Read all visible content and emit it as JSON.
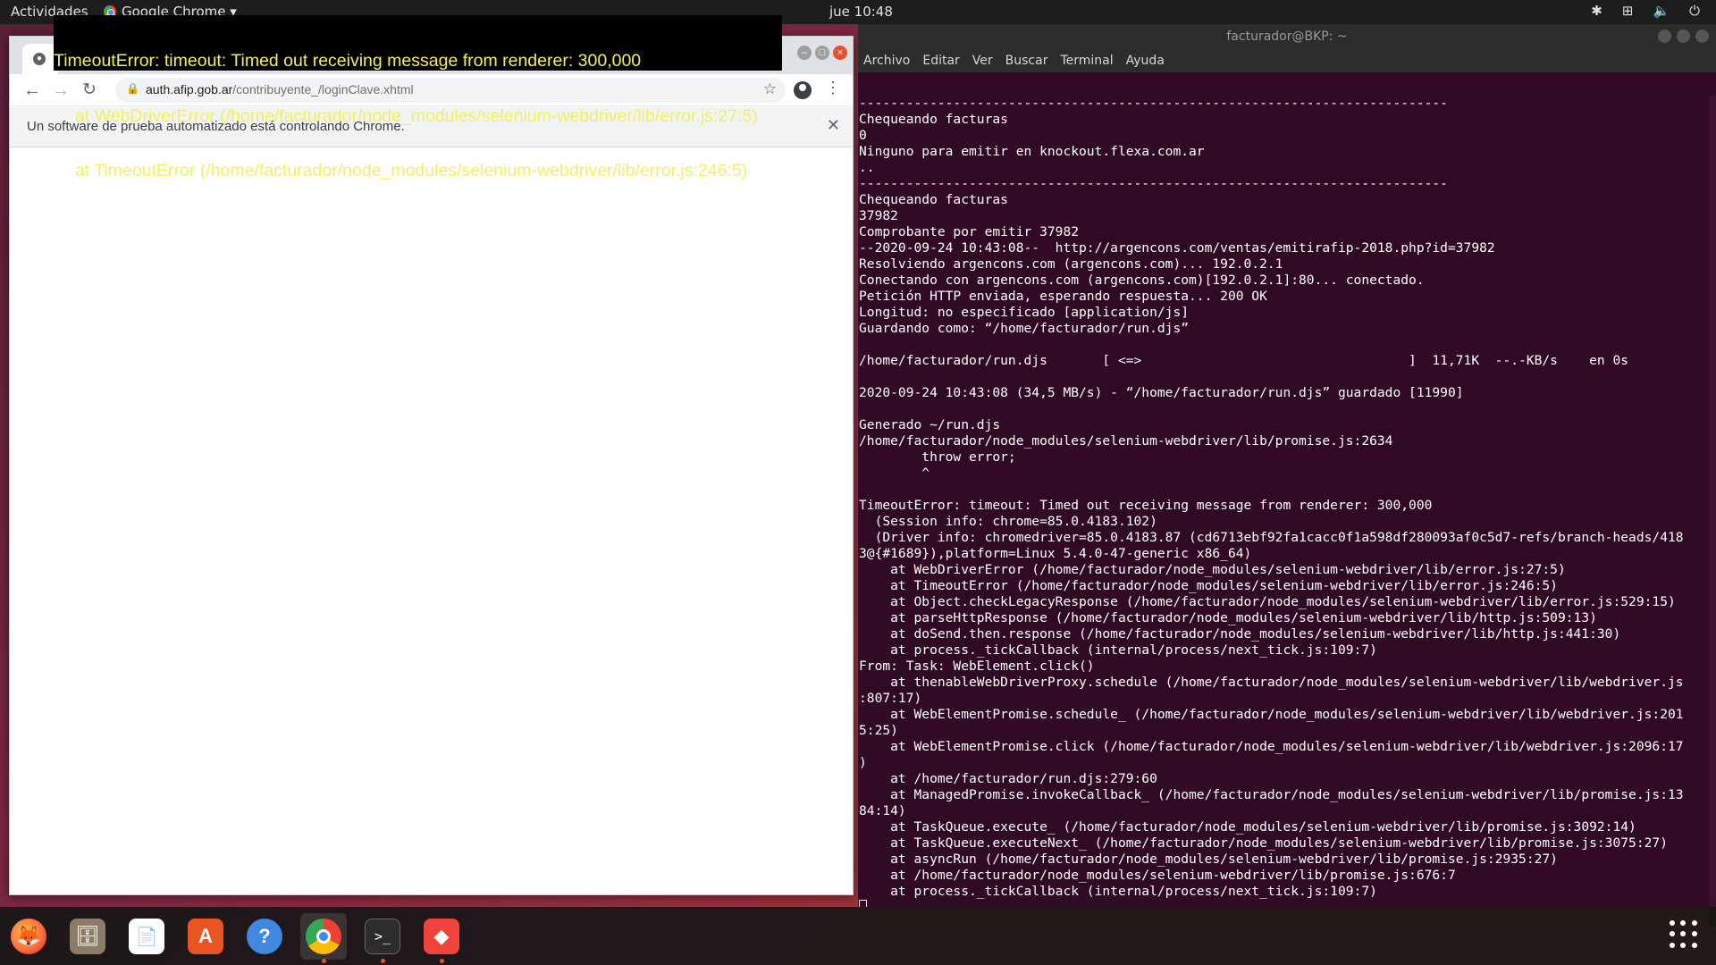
{
  "topbar": {
    "activities": "Actividades",
    "app_menu": "Google Chrome ▾",
    "clock": "jue 10:48",
    "tray_icons": [
      "bluetooth-icon",
      "network-icon",
      "volume-icon",
      "power-icon"
    ]
  },
  "notification": {
    "lines": [
      "TimeoutError: timeout: Timed out receiving message from renderer: 300,000",
      "at WebDriverError (/home/facturador/node_modules/selenium-webdriver/lib/error.js:27:5)",
      "at TimeoutError (/home/facturador/node_modules/selenium-webdriver/lib/error.js:246:5)"
    ]
  },
  "chrome": {
    "url_host": "auth.afip.gob.ar",
    "url_path": "/contribuyente_/loginClave.xhtml",
    "infobar_message": "Un software de prueba automatizado está controlando Chrome."
  },
  "terminal": {
    "title": "facturador@BKP: ~",
    "menu": [
      "Archivo",
      "Editar",
      "Ver",
      "Buscar",
      "Terminal",
      "Ayuda"
    ],
    "lines": [
      "---------------------------------------------------------------------------",
      "Chequeando facturas",
      "0",
      "Ninguno para emitir en knockout.flexa.com.ar",
      "..",
      "---------------------------------------------------------------------------",
      "Chequeando facturas",
      "37982",
      "Comprobante por emitir 37982",
      "--2020-09-24 10:43:08--  http://argencons.com/ventas/emitirafip-2018.php?id=37982",
      "Resolviendo argencons.com (argencons.com)... 192.0.2.1",
      "Conectando con argencons.com (argencons.com)[192.0.2.1]:80... conectado.",
      "Petición HTTP enviada, esperando respuesta... 200 OK",
      "Longitud: no especificado [application/js]",
      "Guardando como: “/home/facturador/run.djs”",
      "",
      "/home/facturador/run.djs       [ <=>                                  ]  11,71K  --.-KB/s    en 0s",
      "",
      "2020-09-24 10:43:08 (34,5 MB/s) - “/home/facturador/run.djs” guardado [11990]",
      "",
      "Generado ~/run.djs",
      "/home/facturador/node_modules/selenium-webdriver/lib/promise.js:2634",
      "        throw error;",
      "        ^",
      "",
      "TimeoutError: timeout: Timed out receiving message from renderer: 300,000",
      "  (Session info: chrome=85.0.4183.102)",
      "  (Driver info: chromedriver=85.0.4183.87 (cd6713ebf92fa1cacc0f1a598df280093af0c5d7-refs/branch-heads/418",
      "3@{#1689}),platform=Linux 5.4.0-47-generic x86_64)",
      "    at WebDriverError (/home/facturador/node_modules/selenium-webdriver/lib/error.js:27:5)",
      "    at TimeoutError (/home/facturador/node_modules/selenium-webdriver/lib/error.js:246:5)",
      "    at Object.checkLegacyResponse (/home/facturador/node_modules/selenium-webdriver/lib/error.js:529:15)",
      "    at parseHttpResponse (/home/facturador/node_modules/selenium-webdriver/lib/http.js:509:13)",
      "    at doSend.then.response (/home/facturador/node_modules/selenium-webdriver/lib/http.js:441:30)",
      "    at process._tickCallback (internal/process/next_tick.js:109:7)",
      "From: Task: WebElement.click()",
      "    at thenableWebDriverProxy.schedule (/home/facturador/node_modules/selenium-webdriver/lib/webdriver.js",
      ":807:17)",
      "    at WebElementPromise.schedule_ (/home/facturador/node_modules/selenium-webdriver/lib/webdriver.js:201",
      "5:25)",
      "    at WebElementPromise.click (/home/facturador/node_modules/selenium-webdriver/lib/webdriver.js:2096:17",
      ")",
      "    at /home/facturador/run.djs:279:60",
      "    at ManagedPromise.invokeCallback_ (/home/facturador/node_modules/selenium-webdriver/lib/promise.js:13",
      "84:14)",
      "    at TaskQueue.execute_ (/home/facturador/node_modules/selenium-webdriver/lib/promise.js:3092:14)",
      "    at TaskQueue.executeNext_ (/home/facturador/node_modules/selenium-webdriver/lib/promise.js:3075:27)",
      "    at asyncRun (/home/facturador/node_modules/selenium-webdriver/lib/promise.js:2935:27)",
      "    at /home/facturador/node_modules/selenium-webdriver/lib/promise.js:676:7",
      "    at process._tickCallback (internal/process/next_tick.js:109:7)"
    ]
  },
  "dock": {
    "items": [
      {
        "icon": "firefox-icon",
        "color": "#ff7139"
      },
      {
        "icon": "files-icon",
        "color": "#7a6a55"
      },
      {
        "icon": "writer-icon",
        "color": "#2a6fbf"
      },
      {
        "icon": "software-center-icon",
        "color": "#e95420"
      },
      {
        "icon": "help-icon",
        "color": "#3f8ae0"
      },
      {
        "icon": "chrome-icon",
        "color": "#4285f4"
      },
      {
        "icon": "terminal-icon",
        "color": "#2c2c2c"
      },
      {
        "icon": "anydesk-icon",
        "color": "#ef443b"
      }
    ]
  }
}
